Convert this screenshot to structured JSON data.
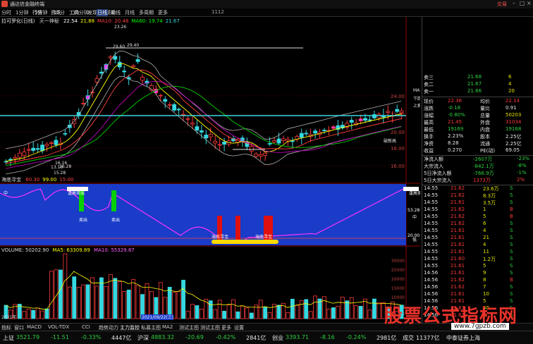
{
  "window": {
    "title": "通达信金融终端",
    "title_right": "交易"
  },
  "menu": {
    "items": [
      "行情",
      "资讯",
      "工具",
      "发现",
      "帮助"
    ],
    "periods": [
      "分时",
      "1分钟",
      "5分钟",
      "15分",
      "30分钟",
      "日线",
      "周线",
      "月线",
      "多周期",
      "更多"
    ],
    "active_period": "日线",
    "extra": "1112"
  },
  "main_chart": {
    "header": "拉可罗化(日线)",
    "indicator_name": "天一神秘",
    "values": [
      {
        "label": "22.54",
        "color": "#ffffff"
      },
      {
        "label": "21.88",
        "color": "#ffff00"
      },
      {
        "label": "MA10: 20.48",
        "color": "#ff4040"
      },
      {
        "label": "MA60: 19.74",
        "color": "#00ff00"
      },
      {
        "label": "21.67",
        "color": "#35d8e0"
      }
    ],
    "price_ticks": [
      "24.00",
      "22.00",
      "20.00",
      "18.00",
      "16.00"
    ],
    "annotations": [
      "23.26",
      "29.60",
      "29.40",
      "13.16",
      "15.28",
      "16.16",
      "16.28",
      "破新高",
      "上推",
      "MA5",
      "下跌"
    ]
  },
  "indicator1": {
    "name": "海底寻宝",
    "values": [
      {
        "label": "60.30",
        "color": "#ff4040"
      },
      {
        "label": "99.00",
        "color": "#ffff00"
      },
      {
        "label": "15.00",
        "color": "#ff4040"
      }
    ],
    "annotations": [
      "逢高卖出",
      "卖出",
      "卖出",
      "海底寻宝",
      "海底寻宝",
      "逢高卖出",
      "中",
      "中",
      "低"
    ],
    "ticks": [
      "53.28",
      "20.00"
    ]
  },
  "volume": {
    "header": "VOLUME: 50202.90",
    "ma5": "MA5: 63309.89",
    "ma10": "MA10: 55329.87",
    "ticks": [
      "30000",
      "25000",
      "20000",
      "15000",
      "10000",
      "5000",
      "X100"
    ],
    "date_label": "2021/09/22(三)",
    "year_label": "2021年"
  },
  "right_panel": {
    "order_book": [
      {
        "label": "卖五",
        "price": "21.70",
        "vol": "23",
        "color": "green"
      },
      {
        "label": "卖四",
        "price": "21.69",
        "vol": "5",
        "color": "green"
      },
      {
        "label": "卖三",
        "price": "21.68",
        "vol": "6",
        "color": "green"
      },
      {
        "label": "卖二",
        "price": "21.67",
        "vol": "4",
        "color": "green"
      },
      {
        "label": "卖一",
        "price": "21.66",
        "vol": "20",
        "color": "green"
      }
    ],
    "quote": [
      {
        "l1": "现价",
        "v1": "22.36",
        "l2": "均价",
        "v2": "22.14",
        "c1": "red",
        "c2": "red"
      },
      {
        "l1": "涨跌",
        "v1": "-0.18",
        "l2": "量比",
        "v2": "0.91",
        "c1": "green",
        "c2": "white"
      },
      {
        "l1": "涨幅",
        "v1": "-0.80%",
        "l2": "总量",
        "v2": "50203",
        "c1": "green",
        "c2": "yellow"
      },
      {
        "l1": "最高",
        "v1": "21.45",
        "l2": "外盘",
        "v2": "31034",
        "c1": "red",
        "c2": "red"
      },
      {
        "l1": "最低",
        "v1": "19169",
        "l2": "内盘",
        "v2": "19168",
        "c1": "green",
        "c2": "green"
      },
      {
        "l1": "换手",
        "v1": "2.23%",
        "l2": "股本",
        "v2": "2.25亿",
        "c1": "white",
        "c2": "white"
      },
      {
        "l1": "净资",
        "v1": "8.28",
        "l2": "流通",
        "v2": "2.25亿",
        "c1": "white",
        "c2": "white"
      },
      {
        "l1": "收益",
        "v1": "0.270",
        "l2": "PE(动)",
        "v2": "69.05",
        "c1": "white",
        "c2": "white"
      }
    ],
    "flows": [
      {
        "label": "净流入额",
        "v1": "-2607万",
        "v2": "-23%",
        "color": "green"
      },
      {
        "label": "大宗流入",
        "v1": "-842.1万",
        "v2": "-8%",
        "color": "green"
      },
      {
        "label": "5日净流入额",
        "v1": "-766.9万",
        "v2": "-1%",
        "color": "green"
      },
      {
        "label": "5日大宗流入",
        "v1": "1373万",
        "v2": "2%",
        "color": "red"
      }
    ],
    "ticks": [
      {
        "t": "14:55",
        "p": "21.62",
        "v": "23.6万",
        "f": "S",
        "pc": "red"
      },
      {
        "t": "14:55",
        "p": "21.62",
        "v": "8.3万",
        "f": "S",
        "pc": "red"
      },
      {
        "t": "14:55",
        "p": "21.61",
        "v": "3.5万",
        "f": "S",
        "pc": "red"
      },
      {
        "t": "14:55",
        "p": "21.62",
        "v": "1",
        "f": "B",
        "pc": "red"
      },
      {
        "t": "14:55",
        "p": "21.62",
        "v": "5",
        "f": "B",
        "pc": "red"
      },
      {
        "t": "14:55",
        "p": "21.62",
        "v": "6",
        "f": "S",
        "pc": "red"
      },
      {
        "t": "14:55",
        "p": "21.61",
        "v": "4",
        "f": "S",
        "pc": "red"
      },
      {
        "t": "14:55",
        "p": "21.61",
        "v": "21",
        "f": "S",
        "pc": "red"
      },
      {
        "t": "14:55",
        "p": "21.61",
        "v": "4",
        "f": "S",
        "pc": "red"
      },
      {
        "t": "14:55",
        "p": "21.61",
        "v": "11",
        "f": "S",
        "pc": "red"
      },
      {
        "t": "14:55",
        "p": "21.60",
        "v": "1.2万",
        "f": "S",
        "pc": "red"
      },
      {
        "t": "14:55",
        "p": "21.61",
        "v": "5",
        "f": "S",
        "pc": "red"
      },
      {
        "t": "14:56",
        "p": "21.61",
        "v": "9",
        "f": "S",
        "pc": "red"
      },
      {
        "t": "14:56",
        "p": "21.62",
        "v": "8",
        "f": "B",
        "pc": "red"
      },
      {
        "t": "14:56",
        "p": "21.62",
        "v": "7",
        "f": "S",
        "pc": "red"
      },
      {
        "t": "14:56",
        "p": "21.61",
        "v": "10",
        "f": "S",
        "pc": "red"
      },
      {
        "t": "14:56",
        "p": "21.61",
        "v": "5",
        "f": "S",
        "pc": "red"
      },
      {
        "t": "14:56",
        "p": "21.61",
        "v": "40",
        "f": "S",
        "pc": "red"
      },
      {
        "t": "14:56",
        "p": "21.61",
        "v": "2",
        "f": "S",
        "pc": "red"
      },
      {
        "t": "14:56",
        "p": "21.61",
        "v": "6",
        "f": "S",
        "pc": "red"
      }
    ]
  },
  "bottom_tabs": [
    "指标",
    "窗口",
    "MACD",
    "VOL-TDX",
    "CCI",
    "趋势动力",
    "主力监控",
    "私募主图",
    "MA2",
    "测试主图",
    "测试主图",
    "更多",
    "设置"
  ],
  "bottom_tabs2": [
    "扩展A",
    "资金分布",
    "综合资讯",
    "行业资讯",
    "互动问答",
    "机构户届利专项"
  ],
  "statusbar": [
    {
      "label": "上证",
      "color": "#e6e6e6"
    },
    {
      "label": "3521.79",
      "color": "#2fd13f"
    },
    {
      "label": "-11.51",
      "color": "#2fd13f"
    },
    {
      "label": "-0.33%",
      "color": "#2fd13f"
    },
    {
      "label": "4447亿",
      "color": "#e6e6e6"
    },
    {
      "label": "沪深",
      "color": "#e6e6e6"
    },
    {
      "label": "4883.32",
      "color": "#2fd13f"
    },
    {
      "label": "-20.69",
      "color": "#2fd13f"
    },
    {
      "label": "-0.42%",
      "color": "#2fd13f"
    },
    {
      "label": "2841亿",
      "color": "#e6e6e6"
    },
    {
      "label": "创业",
      "color": "#e6e6e6"
    },
    {
      "label": "3393.71",
      "color": "#2fd13f"
    },
    {
      "label": "-8.16",
      "color": "#2fd13f"
    },
    {
      "label": "-0.24%",
      "color": "#2fd13f"
    },
    {
      "label": "2981亿",
      "color": "#e6e6e6"
    },
    {
      "label": "成交",
      "color": "#e6e6e6"
    },
    {
      "label": "11377亿",
      "color": "#e6e6e6"
    },
    {
      "label": "中泰证券上海",
      "color": "#e6e6e6"
    }
  ],
  "watermark": {
    "text": "股票公式指标网",
    "url": "www.7gpzb.com"
  }
}
